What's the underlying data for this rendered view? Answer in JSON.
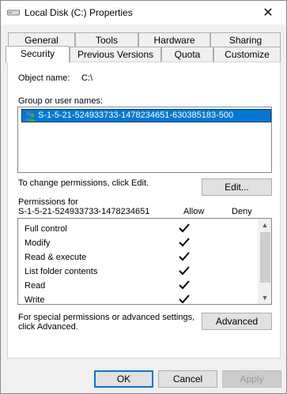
{
  "window": {
    "title": "Local Disk (C:) Properties",
    "close_glyph": "✕"
  },
  "tabs_back": [
    "General",
    "Tools",
    "Hardware",
    "Sharing"
  ],
  "tabs_front": [
    "Security",
    "Previous Versions",
    "Quota",
    "Customize"
  ],
  "object": {
    "label": "Object name:",
    "value": "C:\\"
  },
  "group_users": {
    "label": "Group or user names:",
    "items": [
      "S-1-5-21-524933733-1478234651-630385183-500"
    ]
  },
  "change_permissions": {
    "text": "To change permissions, click Edit.",
    "button": "Edit..."
  },
  "permissions": {
    "label_line1": "Permissions for",
    "label_line2": "S-1-5-21-524933733-1478234651",
    "allow_header": "Allow",
    "deny_header": "Deny",
    "rows": [
      {
        "name": "Full control",
        "allow": true,
        "deny": false
      },
      {
        "name": "Modify",
        "allow": true,
        "deny": false
      },
      {
        "name": "Read & execute",
        "allow": true,
        "deny": false
      },
      {
        "name": "List folder contents",
        "allow": true,
        "deny": false
      },
      {
        "name": "Read",
        "allow": true,
        "deny": false
      },
      {
        "name": "Write",
        "allow": true,
        "deny": false
      }
    ]
  },
  "advanced": {
    "text_line1": "For special permissions or advanced settings,",
    "text_line2": "click Advanced.",
    "button": "Advanced"
  },
  "footer": {
    "ok": "OK",
    "cancel": "Cancel",
    "apply": "Apply"
  },
  "colors": {
    "selection": "#0078d7",
    "accent_border": "#0078d7"
  }
}
